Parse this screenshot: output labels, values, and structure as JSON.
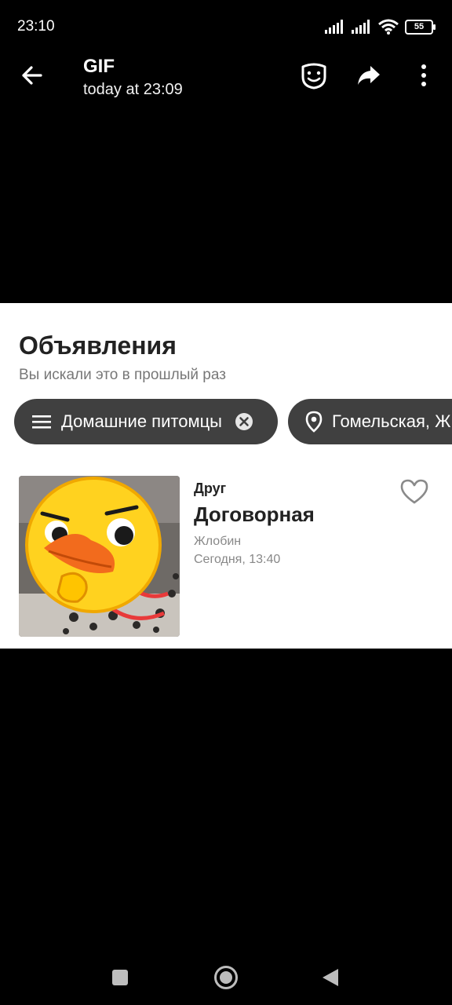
{
  "status_bar": {
    "time": "23:10",
    "battery": "55"
  },
  "viewer": {
    "title": "GIF",
    "subtitle": "today at 23:09"
  },
  "gif": {
    "section_title": "Объявления",
    "section_subtitle": "Вы искали это в прошлый раз",
    "chips": [
      {
        "label": "Домашние питомцы",
        "icon": "list-icon"
      },
      {
        "label": "Гомельская, Ж",
        "icon": "location-pin-icon"
      }
    ],
    "listing": {
      "category": "Друг",
      "price": "Договорная",
      "city": "Жлобин",
      "date": "Сегодня, 13:40"
    }
  },
  "colors": {
    "background": "#000000",
    "panel": "#ffffff",
    "chip": "#404040",
    "sticker": "#ffd21f",
    "beak": "#f26b1d"
  }
}
